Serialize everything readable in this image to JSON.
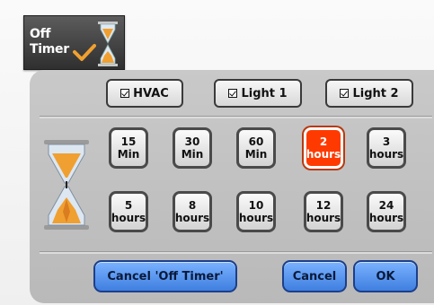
{
  "tab": {
    "label": "Off\nTimer"
  },
  "toggles": [
    {
      "label": "HVAC",
      "checked": true
    },
    {
      "label": "Light 1",
      "checked": true
    },
    {
      "label": "Light 2",
      "checked": true
    }
  ],
  "time_options": [
    {
      "value": "15",
      "unit": "Min",
      "selected": false
    },
    {
      "value": "30",
      "unit": "Min",
      "selected": false
    },
    {
      "value": "60",
      "unit": "Min",
      "selected": false
    },
    {
      "value": "2",
      "unit": "hours",
      "selected": true
    },
    {
      "value": "3",
      "unit": "hours",
      "selected": false
    },
    {
      "value": "5",
      "unit": "hours",
      "selected": false
    },
    {
      "value": "8",
      "unit": "hours",
      "selected": false
    },
    {
      "value": "10",
      "unit": "hours",
      "selected": false
    },
    {
      "value": "12",
      "unit": "hours",
      "selected": false
    },
    {
      "value": "24",
      "unit": "hours",
      "selected": false
    }
  ],
  "actions": {
    "cancel_off_timer": "Cancel 'Off Timer'",
    "cancel": "Cancel",
    "ok": "OK"
  },
  "colors": {
    "selected": "#ff3a00",
    "action_blue": "#5a97f0",
    "panel": "#c2c2c2"
  },
  "icons": [
    "checkmark-icon",
    "hourglass-icon"
  ]
}
